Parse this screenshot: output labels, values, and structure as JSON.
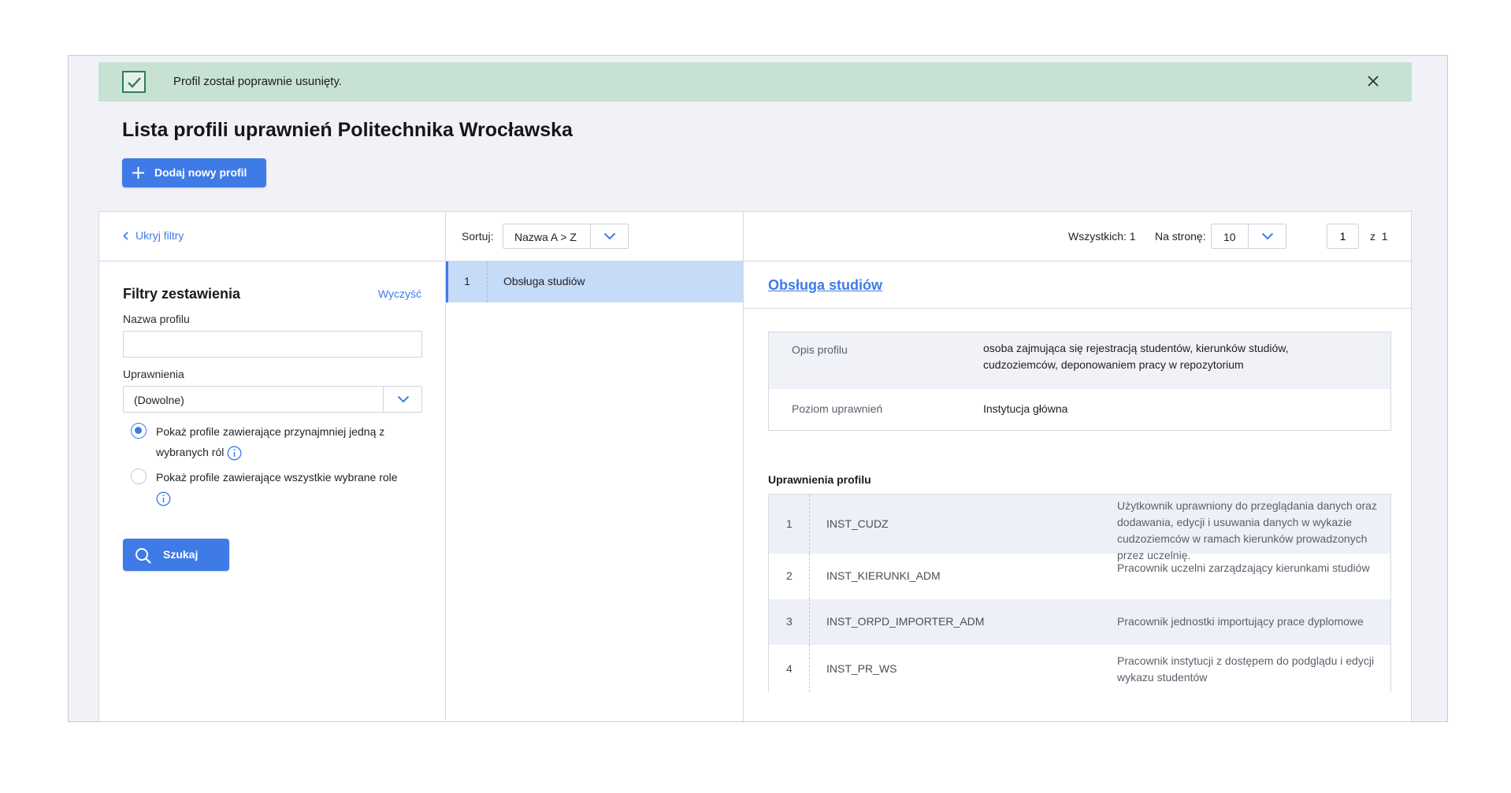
{
  "alert": {
    "message": "Profil został poprawnie usunięty.",
    "icon": "check-icon",
    "close_icon": "close-icon",
    "color": "#c7e1d3"
  },
  "header": {
    "title": "Lista profili uprawnień Politechnika Wrocławska",
    "add_button": "Dodaj nowy profil"
  },
  "filters": {
    "hide_label": "Ukryj filtry",
    "title": "Filtry zestawienia",
    "clear_label": "Wyczyść",
    "name_label": "Nazwa profilu",
    "name_value": "",
    "permissions_label": "Uprawnienia",
    "permissions_value": "(Dowolne)",
    "radio_any": "Pokaż profile zawierające przynajmniej jedną z wybranych ról",
    "radio_all": "Pokaż profile zawierające wszystkie wybrane role",
    "radio_selected": "any",
    "search_button": "Szukaj"
  },
  "toolbar": {
    "sort_label": "Sortuj:",
    "sort_value": "Nazwa A > Z",
    "total_label": "Wszystkich: 1",
    "per_page_label": "Na stronę:",
    "per_page_value": "10",
    "page_value": "1",
    "page_of": "z  1"
  },
  "list": [
    {
      "num": "1",
      "name": "Obsługa studiów"
    }
  ],
  "detail": {
    "title": "Obsługa studiów",
    "info": [
      {
        "key": "Opis profilu",
        "value": "osoba zajmująca się rejestracją studentów, kierunków studiów, cudzoziemców, deponowaniem pracy w repozytorium"
      },
      {
        "key": "Poziom uprawnień",
        "value": "Instytucja główna"
      }
    ],
    "permissions_heading": "Uprawnienia profilu",
    "permissions": [
      {
        "num": "1",
        "code": "INST_CUDZ",
        "desc": "Użytkownik uprawniony do przeglądania danych oraz dodawania, edycji i usuwania danych w wykazie cudzoziemców w ramach kierunków prowadzonych przez uczelnię."
      },
      {
        "num": "2",
        "code": "INST_KIERUNKI_ADM",
        "desc": "Pracownik uczelni zarządzający kierunkami studiów"
      },
      {
        "num": "3",
        "code": "INST_ORPD_IMPORTER_ADM",
        "desc": "Pracownik jednostki importujący prace dyplomowe"
      },
      {
        "num": "4",
        "code": "INST_PR_WS",
        "desc": "Pracownik instytucji z dostępem do podglądu i edycji wykazu studentów"
      }
    ]
  },
  "colors": {
    "accent": "#3f7be6",
    "selected_row": "#c6dbf8",
    "background": "#f1f2f8"
  }
}
